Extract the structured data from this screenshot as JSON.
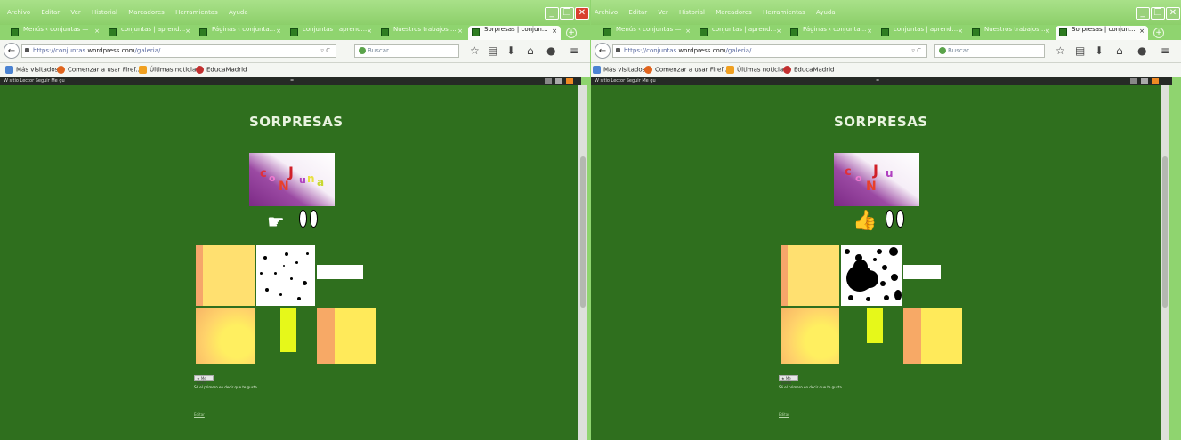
{
  "menu": [
    "Archivo",
    "Editar",
    "Ver",
    "Historial",
    "Marcadores",
    "Herramientas",
    "Ayuda"
  ],
  "tabs_left": [
    {
      "label": "Menús ‹ conjuntas —",
      "close": "×"
    },
    {
      "label": "conjuntas | aprend...",
      "close": "×"
    },
    {
      "label": "Páginas ‹ conjunta...",
      "close": "×"
    },
    {
      "label": "conjuntas | aprend...",
      "close": "×"
    },
    {
      "label": "Nuestros trabajos ...",
      "close": "×"
    },
    {
      "label": "Sorpresas | conjun...",
      "close": "×",
      "active": true
    }
  ],
  "tabs_right": [
    {
      "label": "Menús ‹ conjuntas —",
      "close": "×"
    },
    {
      "label": "conjuntas | aprend...",
      "close": "×"
    },
    {
      "label": "Páginas ‹ conjunta...",
      "close": "×"
    },
    {
      "label": "conjuntas | aprend...",
      "close": "×"
    },
    {
      "label": "Nuestros trabajos ...",
      "close": "×"
    },
    {
      "label": "Sorpresas | conjun...",
      "close": "×",
      "active": true
    }
  ],
  "url": {
    "prefix": "https://conjuntas.",
    "host": "wordpress.com",
    "path": "/galeria/"
  },
  "search_placeholder": "Buscar",
  "bookmarks": [
    "Más visitados",
    "Comenzar a usar Firef...",
    "Últimas noticias",
    "EducaMadrid"
  ],
  "wpbar": {
    "items": "W sitio   Lector   Seguir   Me gu",
    "mid": "="
  },
  "page": {
    "title": "SORPRESAS",
    "logo_letters": [
      "c",
      "o",
      "N",
      "J",
      "u",
      "n",
      "t",
      "a"
    ],
    "like_button": "Me gusta",
    "first_like": "Sé el primero en decir que te gusta.",
    "link": "Editar"
  },
  "colors": {
    "chrome": "#8fd46f",
    "page_bg": "#2f6f1e",
    "title": "#e8f3df"
  }
}
